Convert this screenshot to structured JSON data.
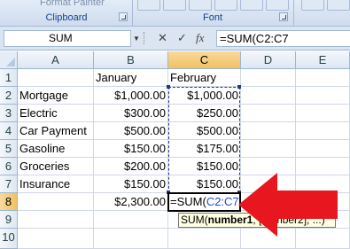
{
  "ribbon": {
    "groups": [
      {
        "label": "Clipboard"
      },
      {
        "label": "Font"
      }
    ],
    "format_painter_label": "Format Painter"
  },
  "formula_bar": {
    "name_box": "SUM",
    "cancel_glyph": "✕",
    "enter_glyph": "✓",
    "fx_label": "fx",
    "formula": "=SUM(C2:C7"
  },
  "sheet": {
    "columns": [
      "A",
      "B",
      "C",
      "D",
      "E"
    ],
    "rows": [
      "1",
      "2",
      "3",
      "4",
      "5",
      "6",
      "7",
      "8",
      "9",
      "10"
    ],
    "header_row": {
      "b": "January",
      "c": "February"
    },
    "items": [
      {
        "label": "Mortgage",
        "jan": "$1,000.00",
        "feb": "$1,000.00"
      },
      {
        "label": "Electric",
        "jan": "$300.00",
        "feb": "$250.00"
      },
      {
        "label": "Car Payment",
        "jan": "$500.00",
        "feb": "$500.00"
      },
      {
        "label": "Gasoline",
        "jan": "$150.00",
        "feb": "$175.00"
      },
      {
        "label": "Groceries",
        "jan": "$200.00",
        "feb": "$150.00"
      },
      {
        "label": "Insurance",
        "jan": "$150.00",
        "feb": "$150.00"
      }
    ],
    "total_jan": "$2,300.00",
    "active_cell": {
      "prefix": "=SUM(",
      "ref": "C2:C7"
    },
    "tooltip": {
      "func": "SUM(",
      "arg1": "number1",
      "rest": ", [number2], ...)"
    }
  },
  "colors": {
    "arrow": "#e8161e",
    "range_reference": "#1f4bd1",
    "active_header": "#f1c15f"
  }
}
